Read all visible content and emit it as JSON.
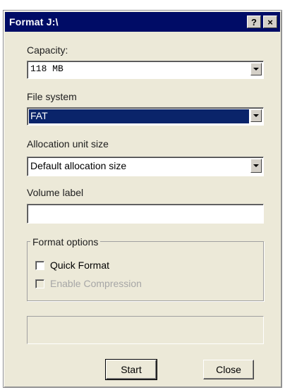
{
  "window": {
    "title": "Format J:\\",
    "help_button": "?",
    "close_button": "×"
  },
  "capacity": {
    "label": "Capacity:",
    "mnemonic": "p",
    "value": "118 MB"
  },
  "file_system": {
    "label": "File system",
    "value": "FAT"
  },
  "allocation": {
    "label": "Allocation unit size",
    "value": "Default allocation size"
  },
  "volume_label": {
    "label": "Volume label",
    "value": ""
  },
  "format_options": {
    "title": "Format options",
    "quick_format": {
      "label": "Quick Format",
      "checked": false,
      "enabled": true
    },
    "enable_compression": {
      "label": "Enable Compression",
      "checked": false,
      "enabled": false
    }
  },
  "progress": {
    "value": 0
  },
  "buttons": {
    "start": "Start",
    "close": "Close"
  },
  "colors": {
    "titlebar": "#000c66",
    "dialog_bg": "#ece9d8",
    "selection": "#0a246a"
  }
}
